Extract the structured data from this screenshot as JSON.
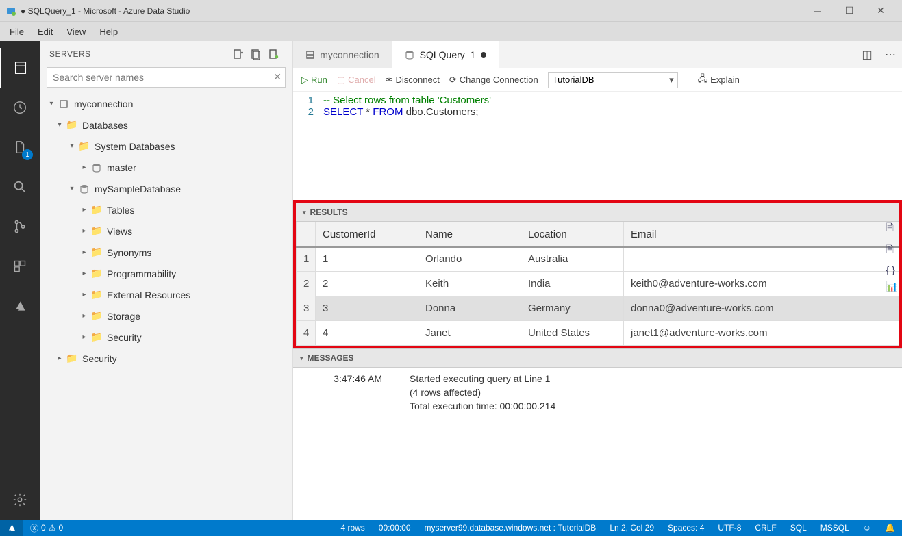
{
  "window": {
    "title": "● SQLQuery_1 - Microsoft - Azure Data Studio"
  },
  "menubar": [
    "File",
    "Edit",
    "View",
    "Help"
  ],
  "sidebar": {
    "title": "SERVERS",
    "search_placeholder": "Search server names",
    "tree": {
      "connection": "myconnection",
      "databases_label": "Databases",
      "system_db_label": "System Databases",
      "master_label": "master",
      "sample_db": "mySampleDatabase",
      "folders": [
        "Tables",
        "Views",
        "Synonyms",
        "Programmability",
        "External Resources",
        "Storage",
        "Security"
      ],
      "top_security": "Security"
    }
  },
  "tabs": {
    "conn": "myconnection",
    "query": "SQLQuery_1"
  },
  "toolbar": {
    "run": "Run",
    "cancel": "Cancel",
    "disconnect": "Disconnect",
    "change_conn": "Change Connection",
    "db": "TutorialDB",
    "explain": "Explain"
  },
  "code": {
    "l1_num": "1",
    "l2_num": "2",
    "l1_comment": "-- Select rows from table 'Customers'",
    "l2_select": "SELECT",
    "l2_star": " * ",
    "l2_from": "FROM",
    "l2_rest": " dbo.Customers;"
  },
  "results": {
    "header": "RESULTS",
    "columns": [
      "CustomerId",
      "Name",
      "Location",
      "Email"
    ],
    "rows": [
      {
        "n": "1",
        "id": "1",
        "name": "Orlando",
        "loc": "Australia",
        "email": ""
      },
      {
        "n": "2",
        "id": "2",
        "name": "Keith",
        "loc": "India",
        "email": "keith0@adventure-works.com"
      },
      {
        "n": "3",
        "id": "3",
        "name": "Donna",
        "loc": "Germany",
        "email": "donna0@adventure-works.com"
      },
      {
        "n": "4",
        "id": "4",
        "name": "Janet",
        "loc": "United States",
        "email": "janet1@adventure-works.com"
      }
    ]
  },
  "messages": {
    "header": "MESSAGES",
    "ts": "3:47:46 AM",
    "line1": "Started executing query at Line 1",
    "line2": "(4 rows affected)",
    "line3": "Total execution time: 00:00:00.214"
  },
  "status": {
    "errors": "0",
    "warnings": "0",
    "rows": "4 rows",
    "elapsed": "00:00:00",
    "server": "myserver99.database.windows.net : TutorialDB",
    "pos": "Ln 2, Col 29",
    "spaces": "Spaces: 4",
    "enc": "UTF-8",
    "eol": "CRLF",
    "lang": "SQL",
    "kernel": "MSSQL"
  }
}
